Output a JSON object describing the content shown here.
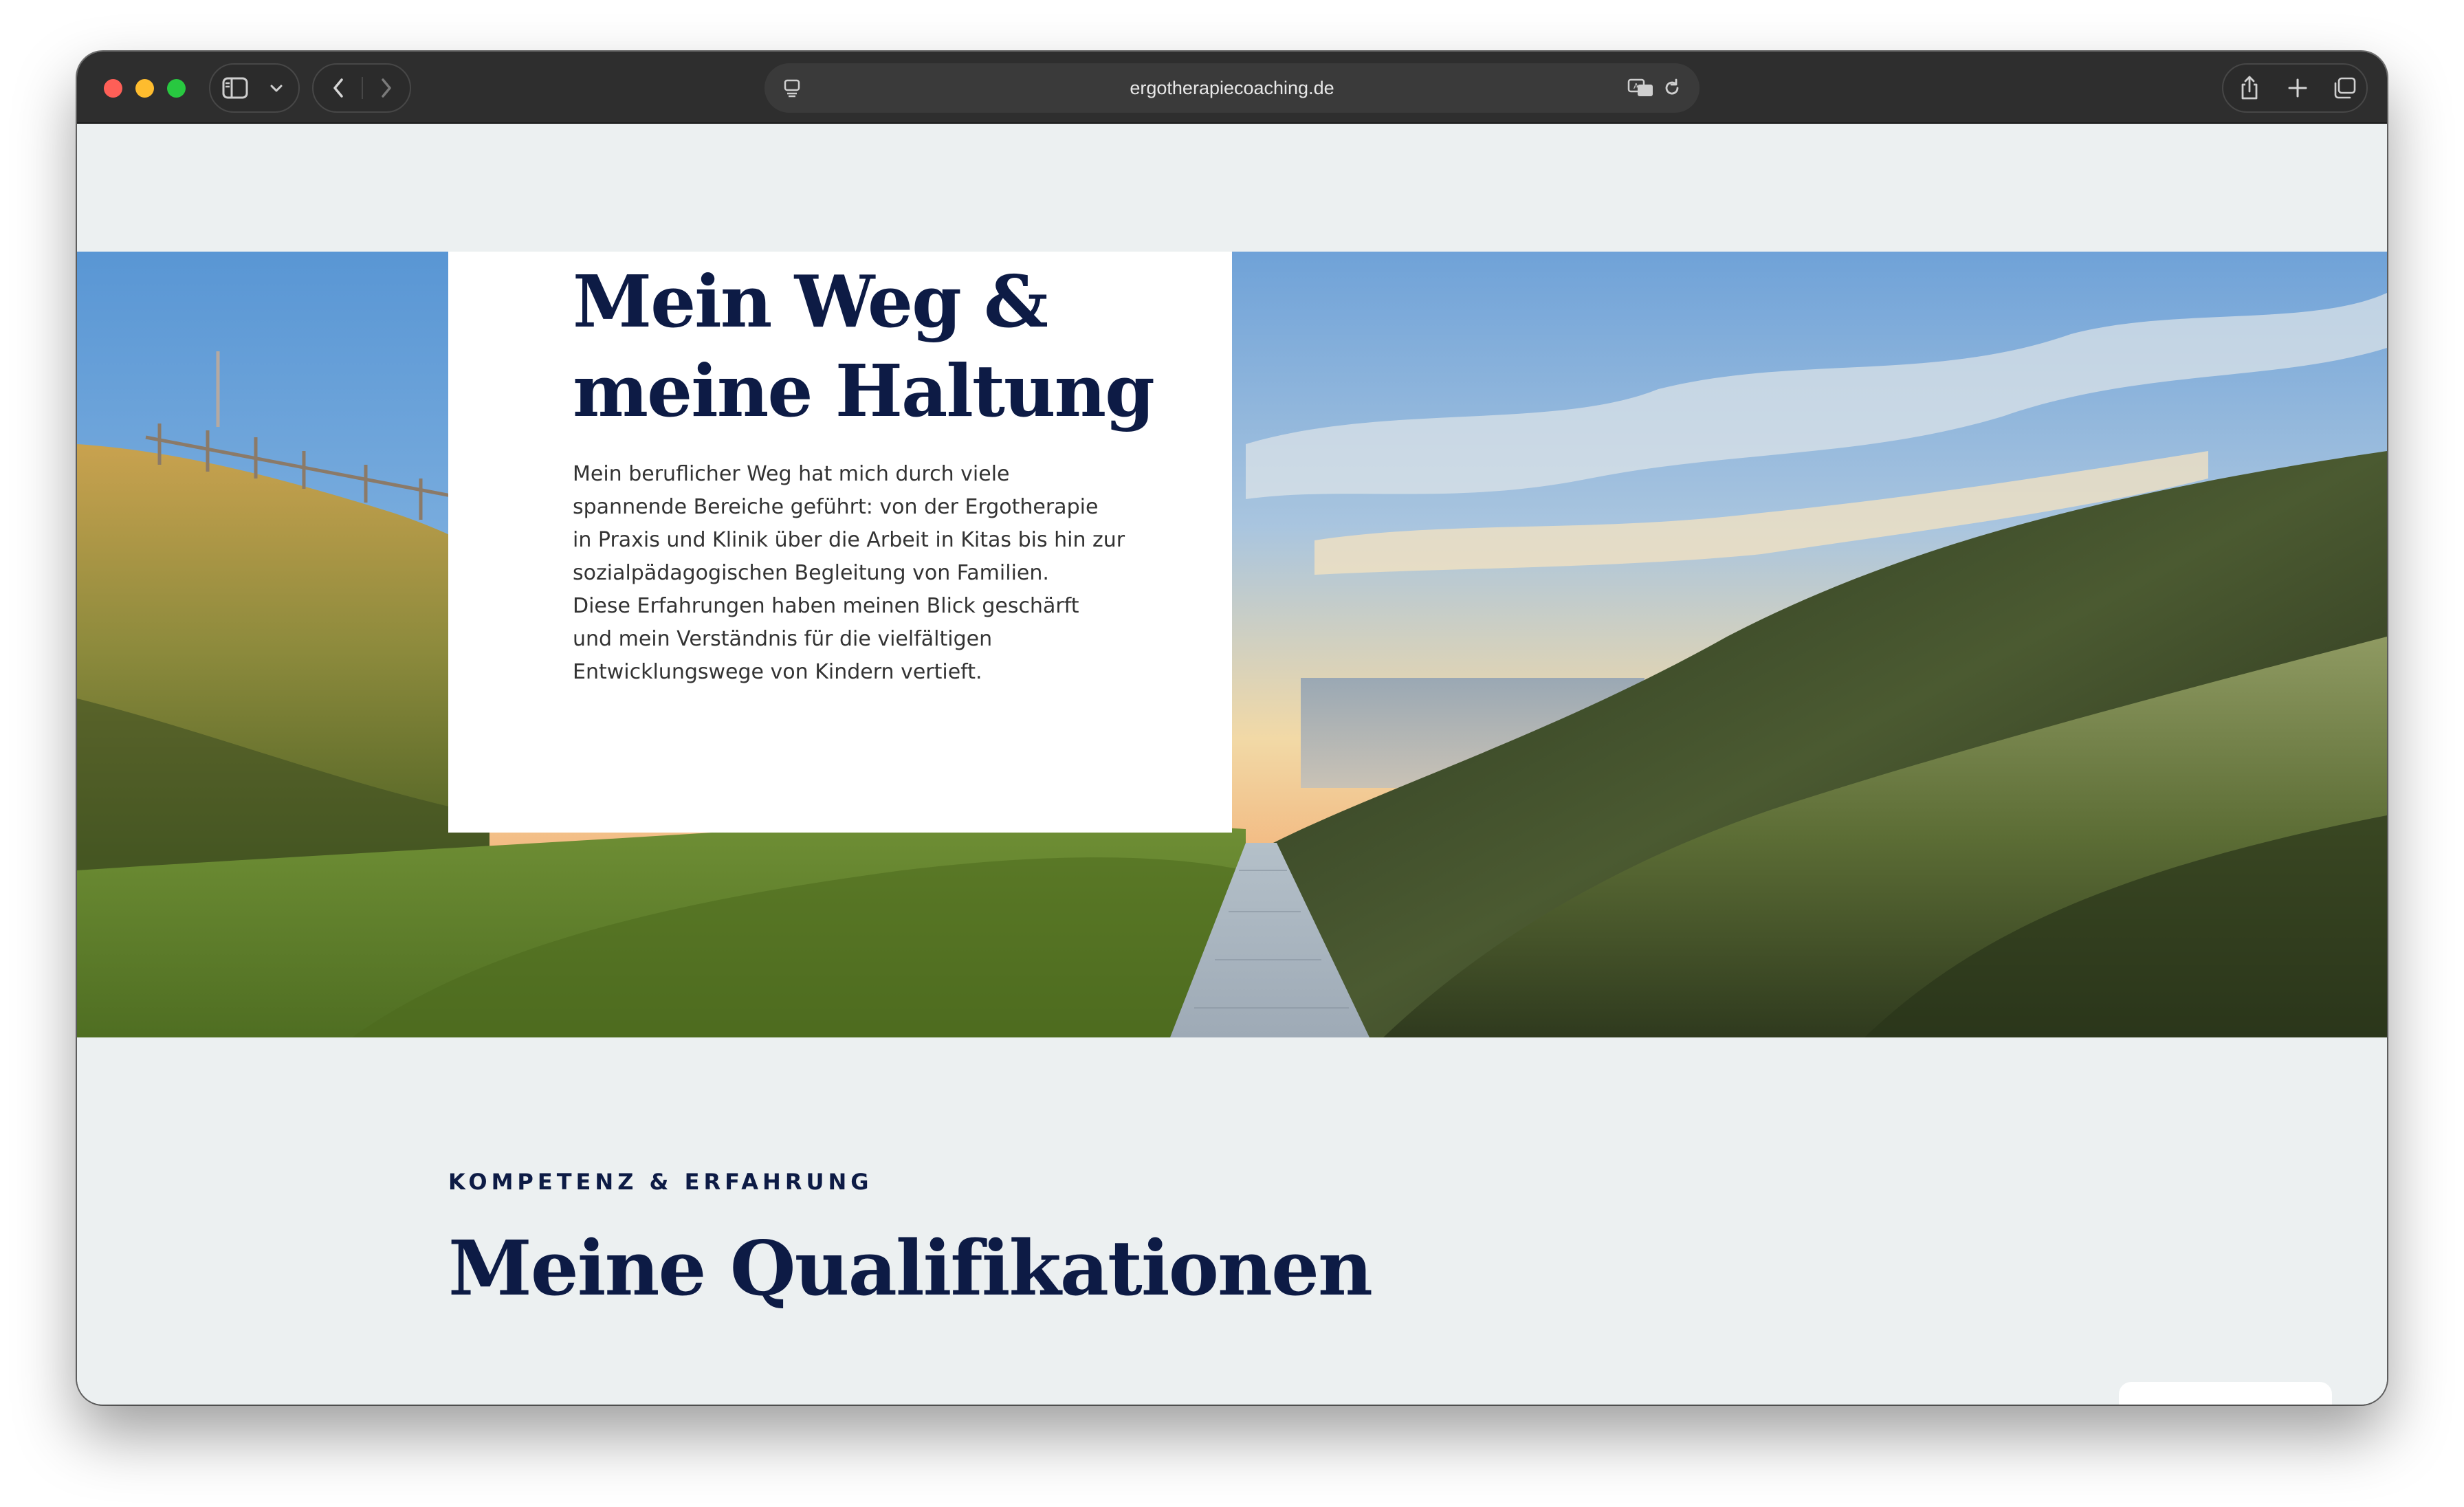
{
  "browser": {
    "url": "ergotherapiecoaching.de",
    "icons": {
      "sidebar": "sidebar-icon",
      "tab_group": "chevron-down-icon",
      "back": "chevron-left-icon",
      "forward": "chevron-right-icon",
      "reader": "reader-icon",
      "translate": "translate-icon",
      "reload": "reload-icon",
      "share": "share-icon",
      "new_tab": "plus-icon",
      "tab_overview": "tabs-icon"
    }
  },
  "intro": {
    "title_line1": "Mein Weg &",
    "title_line2": "meine Haltung",
    "body_lines": [
      "Mein beruflicher Weg hat mich durch viele",
      "spannende Bereiche geführt: von der Ergotherapie",
      "in Praxis und Klinik über die Arbeit in Kitas bis hin zur",
      "sozialpädagogischen Begleitung von Familien.",
      "Diese Erfahrungen haben meinen Blick geschärft",
      "und mein Verständnis für die vielfältigen",
      "Entwicklungswege von Kindern vertieft."
    ]
  },
  "qualifications": {
    "eyebrow": "KOMPETENZ & ERFAHRUNG",
    "title": "Meine Qualifikationen"
  },
  "colors": {
    "navy": "#0d1b45",
    "page_bg": "#ecf0f1",
    "toolbar": "#2e2e2e"
  }
}
